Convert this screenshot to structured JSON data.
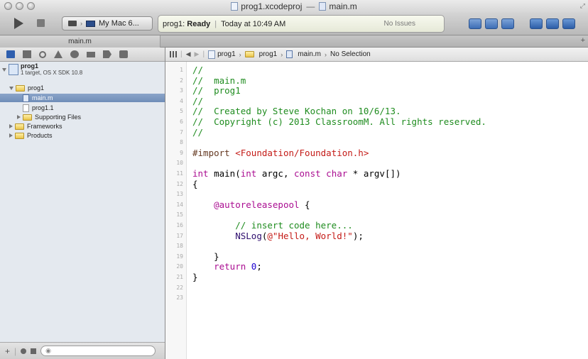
{
  "window": {
    "title_project": "prog1.xcodeproj",
    "title_separator": "—",
    "title_file": "main.m"
  },
  "toolbar": {
    "scheme_label": "My Mac 6...",
    "activity_project": "prog1:",
    "activity_status": "Ready",
    "activity_time": "Today at 10:49 AM",
    "activity_issues": "No Issues"
  },
  "tab": {
    "label": "main.m"
  },
  "navigator": {
    "project_name": "prog1",
    "project_sub": "1 target, OS X SDK 10.8",
    "items": [
      {
        "label": "prog1",
        "kind": "group"
      },
      {
        "label": "main.m",
        "kind": "m-file"
      },
      {
        "label": "prog1.1",
        "kind": "file"
      },
      {
        "label": "Supporting Files",
        "kind": "group"
      },
      {
        "label": "Frameworks",
        "kind": "group"
      },
      {
        "label": "Products",
        "kind": "group"
      }
    ],
    "filter_placeholder": ""
  },
  "jumpbar": {
    "crumbs": [
      "prog1",
      "prog1",
      "main.m",
      "No Selection"
    ]
  },
  "editor": {
    "line_numbers": [
      "1",
      "2",
      "3",
      "4",
      "5",
      "6",
      "7",
      "8",
      "9",
      "10",
      "11",
      "12",
      "13",
      "14",
      "15",
      "16",
      "17",
      "18",
      "19",
      "20",
      "21",
      "22",
      "23"
    ],
    "lines": [
      "//",
      "//  main.m",
      "//  prog1",
      "//",
      "//  Created by Steve Kochan on 10/6/13.",
      "//  Copyright (c) 2013 ClassroomM. All rights reserved.",
      "//",
      "",
      "#import <Foundation/Foundation.h>",
      "",
      "int main(int argc, const char * argv[])",
      "{",
      "",
      "    @autoreleasepool {",
      "",
      "        // insert code here...",
      "        NSLog(@\"Hello, World!\");",
      "",
      "    }",
      "    return 0;",
      "}",
      "",
      ""
    ]
  },
  "colors": {
    "comment": "#1f8c1f",
    "keyword": "#aa0d91",
    "string": "#c41a16",
    "number": "#1c00cf",
    "selection": "#7d98c2"
  }
}
